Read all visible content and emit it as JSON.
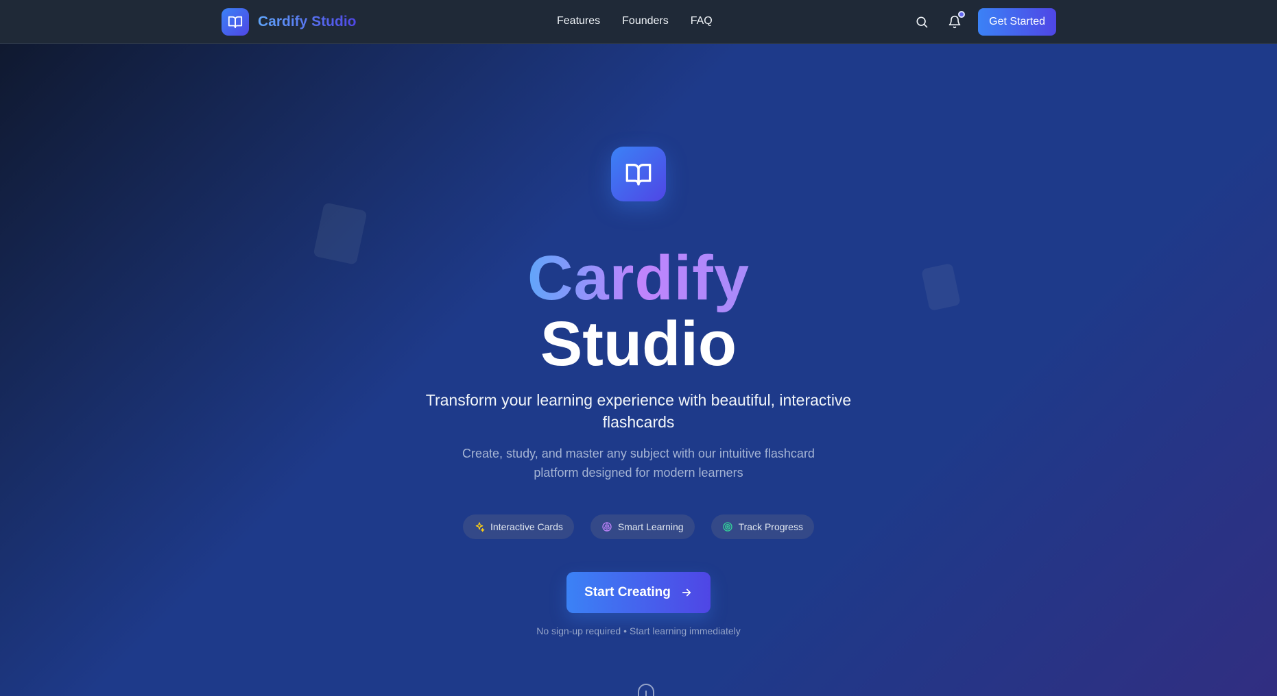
{
  "nav": {
    "brand_name": "Cardify Studio",
    "brand_icon": "book-open-icon",
    "links": [
      {
        "label": "Features"
      },
      {
        "label": "Founders"
      },
      {
        "label": "FAQ"
      }
    ],
    "search_icon": "search-icon",
    "bell_icon": "bell-icon",
    "cta_label": "Get Started"
  },
  "hero": {
    "icon": "book-open-icon",
    "title_line1": "Cardify",
    "title_line2": "Studio",
    "subtitle": "Transform your learning experience with beautiful, interactive flashcards",
    "description": "Create, study, and master any subject with our intuitive flashcard platform designed for modern learners",
    "pills": [
      {
        "label": "Interactive Cards",
        "icon": "sparkles-icon",
        "color": "#facc15"
      },
      {
        "label": "Smart Learning",
        "icon": "brain-icon",
        "color": "#c084fc"
      },
      {
        "label": "Track Progress",
        "icon": "target-icon",
        "color": "#34d399"
      }
    ],
    "start_label": "Start Creating",
    "note": "No sign-up required • Start learning immediately"
  },
  "colors": {
    "accent": "#3b82f6",
    "accent_secondary": "#4f46e5",
    "nav_bg": "#1f2937"
  }
}
